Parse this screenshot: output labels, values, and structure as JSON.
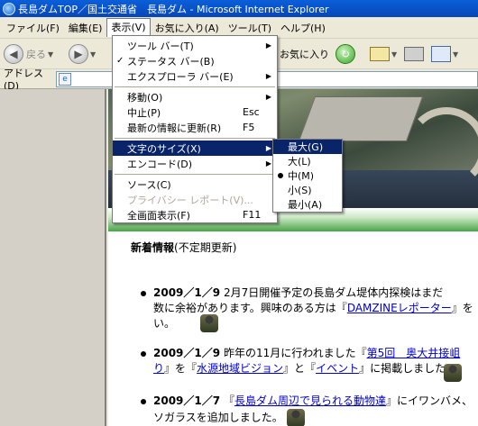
{
  "window": {
    "title": "長島ダムTOP／国土交通省　長島ダム - Microsoft Internet Explorer"
  },
  "menubar": {
    "items": [
      "ファイル(F)",
      "編集(E)",
      "表示(V)",
      "お気に入り(A)",
      "ツール(T)",
      "ヘルプ(H)"
    ]
  },
  "toolbar": {
    "back_label": "戻る",
    "favorites_label": "お気に入り"
  },
  "address": {
    "label": "アドレス(D)",
    "value": ""
  },
  "view_menu": {
    "items": [
      {
        "label": "ツール バー(T)",
        "submenu": true
      },
      {
        "label": "ステータス バー(B)",
        "checked": true
      },
      {
        "label": "エクスプローラ バー(E)",
        "submenu": true
      },
      {
        "label": "移動(O)",
        "submenu": true
      },
      {
        "label": "中止(P)",
        "shortcut": "Esc"
      },
      {
        "label": "最新の情報に更新(R)",
        "shortcut": "F5"
      },
      {
        "label": "文字のサイズ(X)",
        "submenu": true,
        "highlighted": true
      },
      {
        "label": "エンコード(D)",
        "submenu": true
      },
      {
        "label": "ソース(C)"
      },
      {
        "label": "プライバシー レポート(V)...",
        "disabled": true
      },
      {
        "label": "全画面表示(F)",
        "shortcut": "F11"
      }
    ]
  },
  "text_size_menu": {
    "items": [
      "最大(G)",
      "大(L)",
      "中(M)",
      "小(S)",
      "最小(A)"
    ],
    "selected": "中(M)",
    "highlighted": "最大(G)"
  },
  "page": {
    "news_heading_bold": "新着情報",
    "news_heading_note": "(不定期更新)",
    "news": [
      {
        "date": "2009／1／9",
        "line1": "2月7日開催予定の長島ダム堤体内探検はまだ",
        "line2_pre": "数に余裕があります。興味のある方は『",
        "line2_link": "DAMZINEレポーター",
        "line2_post": "』を",
        "line3": "い。"
      },
      {
        "date": "2009／1／9",
        "line1_pre": "昨年の11月に行われました『",
        "line1_link": "第5回　奥大井接岨",
        "line2_link1": "り",
        "line2_mid1": "』を『",
        "line2_link2": "水源地域ビジョン",
        "line2_mid2": "』と『",
        "line2_link3": "イベント",
        "line2_post": "』に掲載しました。"
      },
      {
        "date": "2009／1／7",
        "line1_pre": "『",
        "line1_link": "長島ダム周辺で見られる動物達",
        "line1_post": "』にイワンバメ、",
        "line2": "ソガラスを追加しました。"
      }
    ]
  }
}
